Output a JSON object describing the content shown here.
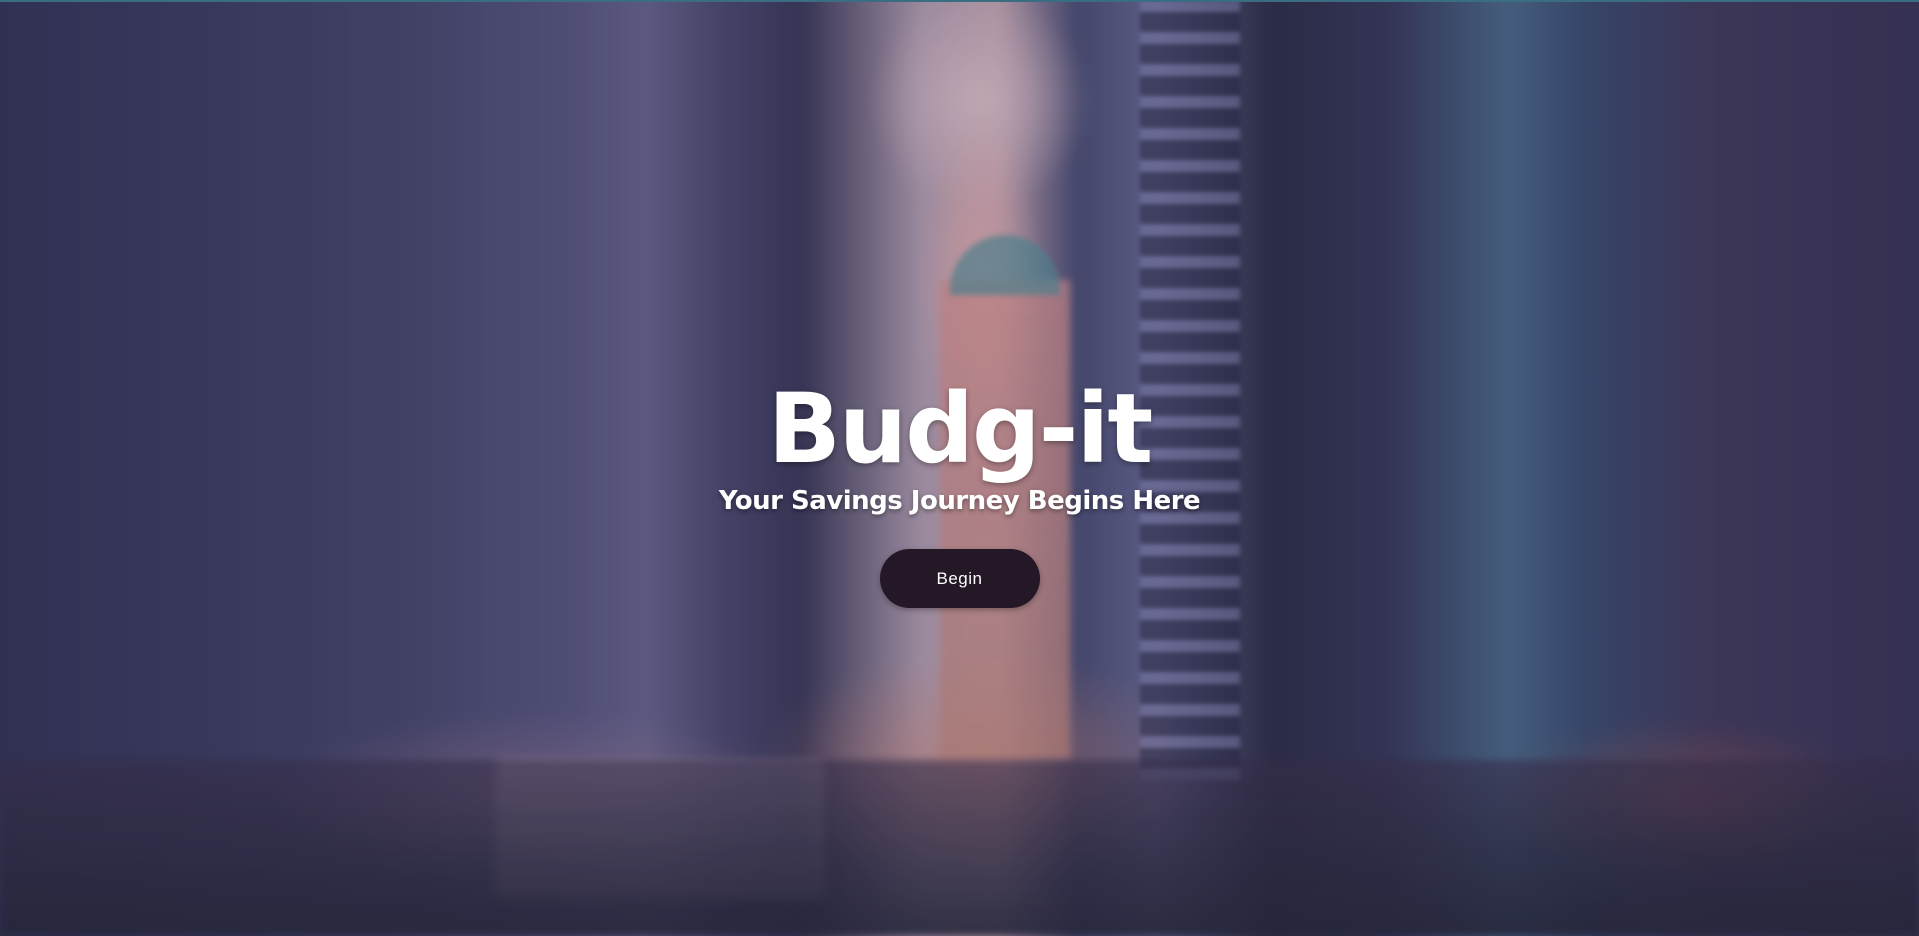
{
  "hero": {
    "title": "Budg-it",
    "subtitle": "Your Savings Journey Begins Here",
    "begin_label": "Begin"
  },
  "colors": {
    "button_background": "#241726",
    "text": "#ffffff",
    "top_border": "#3b6d82"
  }
}
